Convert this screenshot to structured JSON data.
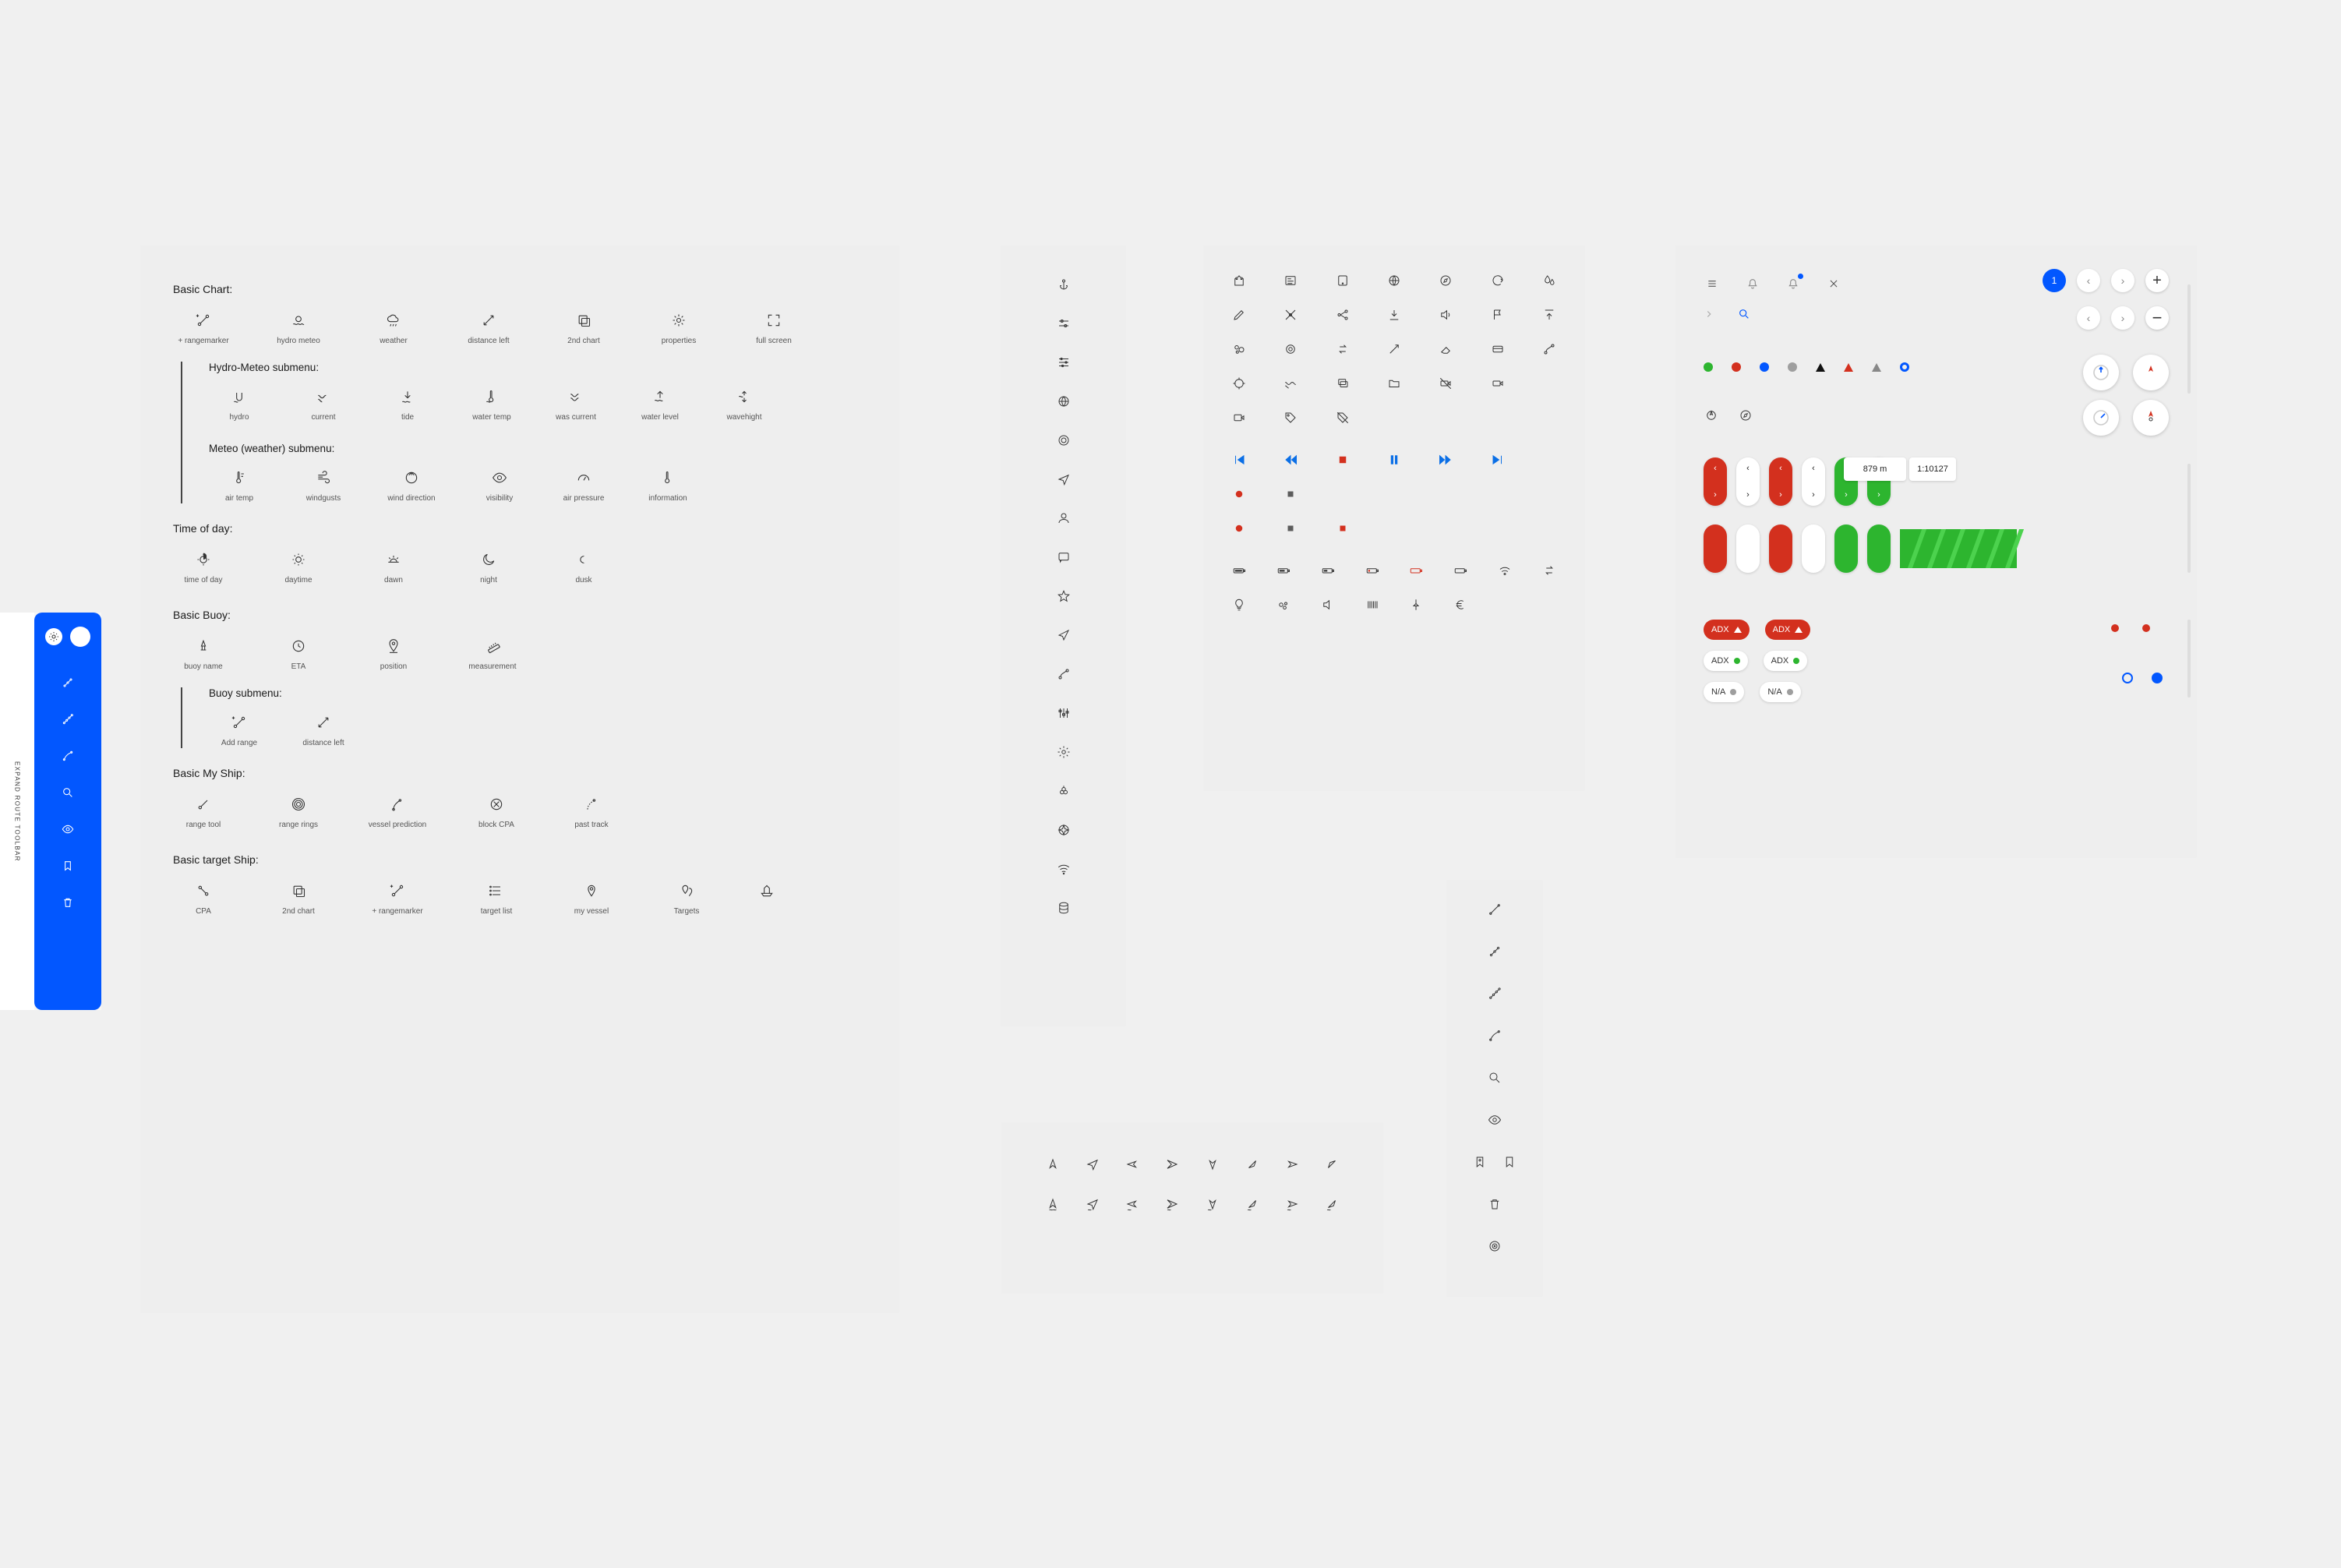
{
  "panel1": {
    "basic_chart": {
      "title": "Basic Chart:",
      "items": [
        {
          "label": "+ rangemarker",
          "icon": "rangemarker-icon"
        },
        {
          "label": "hydro meteo",
          "icon": "hydro-meteo-icon"
        },
        {
          "label": "weather",
          "icon": "weather-icon"
        },
        {
          "label": "distance left",
          "icon": "distance-left-icon"
        },
        {
          "label": "2nd chart",
          "icon": "second-chart-icon"
        },
        {
          "label": "properties",
          "icon": "properties-icon"
        },
        {
          "label": "full screen",
          "icon": "fullscreen-icon"
        }
      ],
      "hydro_submenu": {
        "title": "Hydro-Meteo submenu:",
        "items": [
          {
            "label": "hydro",
            "icon": "hydro-icon"
          },
          {
            "label": "current",
            "icon": "current-icon"
          },
          {
            "label": "tide",
            "icon": "tide-icon"
          },
          {
            "label": "water temp",
            "icon": "water-temp-icon"
          },
          {
            "label": "was current",
            "icon": "was-current-icon"
          },
          {
            "label": "water level",
            "icon": "water-level-icon"
          },
          {
            "label": "wavehight",
            "icon": "waveheight-icon"
          }
        ]
      },
      "meteo_submenu": {
        "title": "Meteo (weather) submenu:",
        "items": [
          {
            "label": "air temp",
            "icon": "air-temp-icon"
          },
          {
            "label": "windgusts",
            "icon": "windgusts-icon"
          },
          {
            "label": "wind direction",
            "icon": "wind-direction-icon"
          },
          {
            "label": "visibility",
            "icon": "visibility-icon"
          },
          {
            "label": "air pressure",
            "icon": "air-pressure-icon"
          },
          {
            "label": "information",
            "icon": "information-icon"
          }
        ]
      }
    },
    "time_of_day": {
      "title": "Time of day:",
      "items": [
        {
          "label": "time of day",
          "icon": "time-of-day-icon"
        },
        {
          "label": "daytime",
          "icon": "daytime-icon"
        },
        {
          "label": "dawn",
          "icon": "dawn-icon"
        },
        {
          "label": "night",
          "icon": "night-icon"
        },
        {
          "label": "dusk",
          "icon": "dusk-icon"
        }
      ]
    },
    "basic_buoy": {
      "title": "Basic Buoy:",
      "items": [
        {
          "label": "buoy name",
          "icon": "buoy-name-icon"
        },
        {
          "label": "ETA",
          "icon": "eta-icon"
        },
        {
          "label": "position",
          "icon": "position-icon"
        },
        {
          "label": "measurement",
          "icon": "measurement-icon"
        }
      ],
      "submenu": {
        "title": "Buoy submenu:",
        "items": [
          {
            "label": "Add range",
            "icon": "add-range-icon"
          },
          {
            "label": "distance left",
            "icon": "distance-left-icon"
          }
        ]
      }
    },
    "basic_my_ship": {
      "title": "Basic My Ship:",
      "items": [
        {
          "label": "range tool",
          "icon": "range-tool-icon"
        },
        {
          "label": "range rings",
          "icon": "range-rings-icon"
        },
        {
          "label": "vessel prediction",
          "icon": "vessel-prediction-icon"
        },
        {
          "label": "block CPA",
          "icon": "block-cpa-icon"
        },
        {
          "label": "past track",
          "icon": "past-track-icon"
        }
      ]
    },
    "basic_target_ship": {
      "title": "Basic target Ship:",
      "items": [
        {
          "label": "CPA",
          "icon": "cpa-icon"
        },
        {
          "label": "2nd chart",
          "icon": "second-chart-icon"
        },
        {
          "label": "+ rangemarker",
          "icon": "rangemarker-icon"
        },
        {
          "label": "target list",
          "icon": "target-list-icon"
        },
        {
          "label": "my vessel",
          "icon": "my-vessel-icon"
        },
        {
          "label": "Targets",
          "icon": "targets-icon"
        }
      ],
      "extra": {
        "icon": "ship-outline-icon"
      }
    }
  },
  "panel2": {
    "icons": [
      "anchor-icon",
      "sliders-a-icon",
      "sliders-b-icon",
      "globe-icon",
      "target-circle-icon",
      "nav-arrow-icon",
      "user-icon",
      "chat-icon",
      "star-icon",
      "location-arrow-icon",
      "route-icon",
      "tune-icon",
      "settings-gear-icon",
      "berry-icon",
      "compass-rose-icon",
      "wifi-icon",
      "database-icon"
    ]
  },
  "panel3": {
    "rows": [
      [
        "castle-icon",
        "form-icon",
        "tablet-icon",
        "globe-2-icon",
        "compass-2-icon",
        "refresh-icon",
        "water-drops-icon"
      ],
      [
        "pencil-icon",
        "ruler-cross-icon",
        "molecule-icon",
        "download-icon",
        "speaker-icon",
        "flag-icon",
        "upload-icon"
      ],
      [
        "bubbles-icon",
        "rings-2-icon",
        "transfer-icon",
        "wand-icon",
        "eraser-icon",
        "card-icon",
        "route-2-icon"
      ],
      [
        "crosshair-icon",
        "waves-icon",
        "card-stack-icon",
        "folder-icon",
        "camera-off-icon",
        "video-icon"
      ],
      [
        "label-icon",
        "tag-2-icon",
        "tag-strike-icon"
      ]
    ],
    "playback": [
      {
        "icon": "skip-back-icon",
        "color": "blue"
      },
      {
        "icon": "rewind-icon",
        "color": "blue"
      },
      {
        "icon": "stop-icon",
        "color": "red"
      },
      {
        "icon": "pause-icon",
        "color": "blue"
      },
      {
        "icon": "forward-icon",
        "color": "blue"
      },
      {
        "icon": "skip-fwd-icon",
        "color": "blue"
      }
    ],
    "status_squares": [
      {
        "icon": "square",
        "color": "red"
      },
      {
        "icon": "square",
        "color": "grey"
      }
    ],
    "status_circles": [
      {
        "icon": "circle",
        "color": "red"
      },
      {
        "icon": "square",
        "color": "grey"
      },
      {
        "icon": "square",
        "color": "red"
      }
    ],
    "batteries": [
      "battery-full-icon",
      "battery-75-icon",
      "battery-50-icon",
      "battery-25-icon",
      "battery-low-icon",
      "battery-empty-icon",
      "wifi-icon",
      "swap-icon"
    ],
    "bottom": [
      "bulb-icon",
      "drops-icon",
      "sound-icon",
      "barcode-icon",
      "pin-2-icon",
      "euro-icon"
    ]
  },
  "panel4": {
    "row1": [
      "cursor-up-icon",
      "cursor-send-icon",
      "cursor-right-icon",
      "cursor-back-icon",
      "cursor-down-icon",
      "cursor-ll-icon",
      "cursor-left-icon",
      "cursor-ne-icon"
    ],
    "row2": [
      "cursor-up-w-icon",
      "cursor-send-w-icon",
      "cursor-right-w-icon",
      "cursor-back-w-icon",
      "cursor-down-w-icon",
      "cursor-ll-w-icon",
      "cursor-left-w-icon",
      "cursor-ne-w-icon"
    ]
  },
  "panel5": {
    "icons": [
      "line-edit-icon",
      "line-nodes-icon",
      "line-nodes-2-icon",
      "line-curve-icon",
      "search-icon",
      "visibility-2-icon",
      "bookmark-pin-icon",
      "bookmark-icon",
      "trash-icon",
      "bullseye-icon"
    ]
  },
  "panel6": {
    "topbar": [
      "list-icon",
      "bell-icon",
      "bell-dot-icon",
      "close-icon"
    ],
    "topbar2": [
      "chevron-right-icon",
      "search-icon"
    ],
    "counter_badge": "1",
    "dots": [
      "green",
      "red",
      "blue",
      "grey",
      "black",
      "red-tri",
      "grey-tri",
      "blue-ring"
    ],
    "info_distance": "879 m",
    "info_scale": "1:10127",
    "chips_red": [
      {
        "text": "ADX",
        "icon": "triangle-up-icon"
      },
      {
        "text": "ADX",
        "icon": "triangle-up-icon"
      }
    ],
    "chips_white_adx": [
      {
        "text": "ADX",
        "color": "green"
      },
      {
        "text": "ADX",
        "color": "green"
      }
    ],
    "chips_white_na": [
      {
        "text": "N/A",
        "color": "grey"
      },
      {
        "text": "N/A",
        "color": "grey"
      }
    ]
  },
  "panel7": {
    "gear": "settings-gear-icon",
    "close": "close-circle-icon",
    "label": "EXPAND ROUTE TOOLBAR",
    "items": [
      "line-nodes-icon",
      "line-nodes-2-icon",
      "line-curve-icon",
      "search-icon",
      "visibility-2-icon",
      "bookmark-pin-icon",
      "trash-icon"
    ]
  }
}
